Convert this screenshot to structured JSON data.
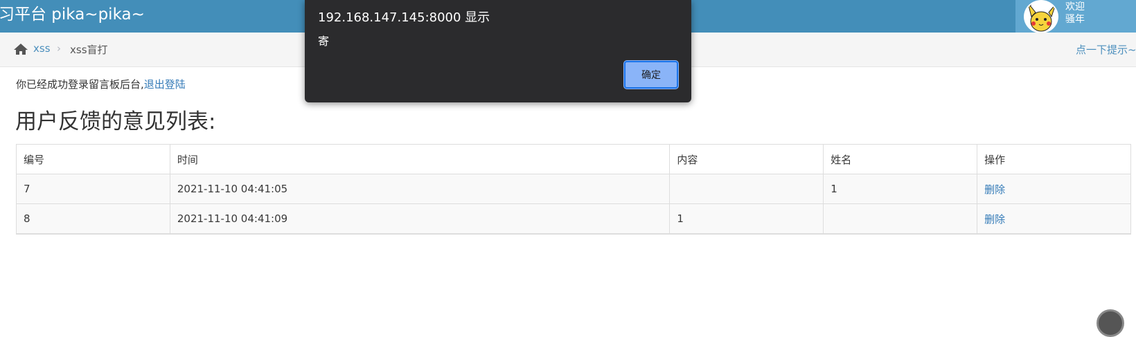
{
  "navbar": {
    "brand": "习平台 pika~pika~",
    "welcome_line1": "欢迎",
    "welcome_line2": "骚年"
  },
  "breadcrumb": {
    "home_icon": "home-icon",
    "link": "xss",
    "separator": "›",
    "current": "xss盲打",
    "hint": "点一下提示~"
  },
  "content": {
    "login_text": "你已经成功登录留言板后台,",
    "logout_link": "退出登陆",
    "title": "用户反馈的意见列表:"
  },
  "table": {
    "headers": [
      "编号",
      "时间",
      "内容",
      "姓名",
      "操作"
    ],
    "rows": [
      {
        "id": "7",
        "time": "2021-11-10 04:41:05",
        "content": "",
        "name": "1",
        "action": "删除"
      },
      {
        "id": "8",
        "time": "2021-11-10 04:41:09",
        "content": "1",
        "name": "",
        "action": "删除"
      }
    ]
  },
  "alert": {
    "origin": "192.168.147.145:8000 显示",
    "message": "寄",
    "ok_label": "确定"
  }
}
